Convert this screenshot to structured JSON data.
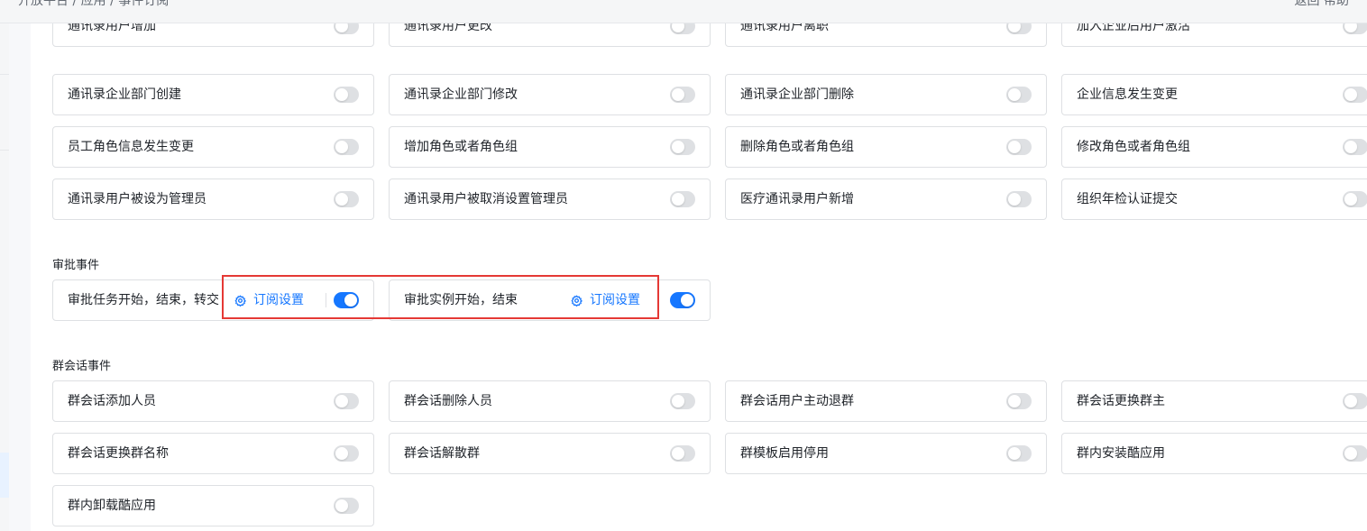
{
  "topbar": {
    "breadcrumb": "开放平台 / 应用 / 事件订阅",
    "right_text": "返回  帮助"
  },
  "sections": {
    "approval_title": "审批事件",
    "group_title": "群会话事件"
  },
  "partial_row": [
    {
      "label": "通讯录用户增加",
      "enabled": false
    },
    {
      "label": "通讯录用户更改",
      "enabled": false
    },
    {
      "label": "通讯录用户离职",
      "enabled": false
    },
    {
      "label": "加入企业后用户激活",
      "enabled": false
    }
  ],
  "contacts_rows": [
    [
      {
        "label": "通讯录企业部门创建",
        "enabled": false
      },
      {
        "label": "通讯录企业部门修改",
        "enabled": false
      },
      {
        "label": "通讯录企业部门删除",
        "enabled": false
      },
      {
        "label": "企业信息发生变更",
        "enabled": false
      }
    ],
    [
      {
        "label": "员工角色信息发生变更",
        "enabled": false
      },
      {
        "label": "增加角色或者角色组",
        "enabled": false
      },
      {
        "label": "删除角色或者角色组",
        "enabled": false
      },
      {
        "label": "修改角色或者角色组",
        "enabled": false
      }
    ],
    [
      {
        "label": "通讯录用户被设为管理员",
        "enabled": false
      },
      {
        "label": "通讯录用户被取消设置管理员",
        "enabled": false
      },
      {
        "label": "医疗通讯录用户新增",
        "enabled": false
      },
      {
        "label": "组织年检认证提交",
        "enabled": false
      }
    ]
  ],
  "approval": [
    {
      "label": "审批任务开始，结束，转交",
      "link": "订阅设置",
      "enabled": true
    },
    {
      "label": "审批实例开始，结束",
      "link": "订阅设置",
      "enabled": true
    }
  ],
  "group_rows": [
    [
      {
        "label": "群会话添加人员",
        "enabled": false
      },
      {
        "label": "群会话删除人员",
        "enabled": false
      },
      {
        "label": "群会话用户主动退群",
        "enabled": false
      },
      {
        "label": "群会话更换群主",
        "enabled": false
      }
    ],
    [
      {
        "label": "群会话更换群名称",
        "enabled": false
      },
      {
        "label": "群会话解散群",
        "enabled": false
      },
      {
        "label": "群模板启用停用",
        "enabled": false
      },
      {
        "label": "群内安装酷应用",
        "enabled": false
      }
    ],
    [
      {
        "label": "群内卸载酷应用",
        "enabled": false
      }
    ]
  ],
  "icons": {
    "settings": "gear-icon"
  },
  "colors": {
    "accent": "#1677ff",
    "highlight_box": "#e53935",
    "toggle_off": "#dee0e3"
  }
}
